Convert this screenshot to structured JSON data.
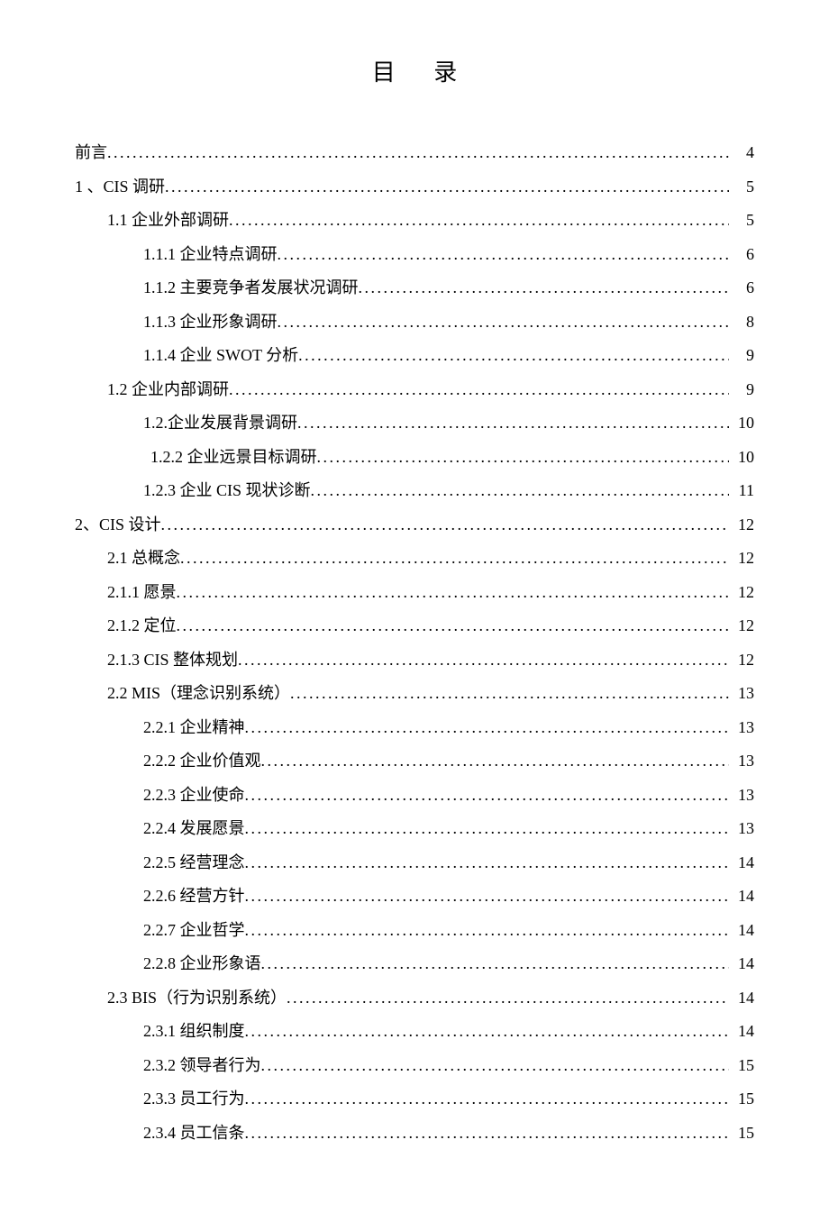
{
  "title": "目 录",
  "entries": [
    {
      "indent": 0,
      "label": "前言",
      "page": "4"
    },
    {
      "indent": 0,
      "label": "1 、CIS 调研",
      "page": "5"
    },
    {
      "indent": 1,
      "label": "1.1 企业外部调研",
      "page": "5"
    },
    {
      "indent": 2,
      "label": "1.1.1 企业特点调研",
      "page": "6"
    },
    {
      "indent": 2,
      "label": "1.1.2 主要竞争者发展状况调研",
      "page": "6"
    },
    {
      "indent": 2,
      "label": "1.1.3 企业形象调研",
      "page": "8"
    },
    {
      "indent": 2,
      "label": "1.1.4 企业 SWOT 分析",
      "page": " 9"
    },
    {
      "indent": 1,
      "label": "1.2 企业内部调研",
      "page": "9"
    },
    {
      "indent": 2,
      "label": "1.2.企业发展背景调研",
      "page": "10"
    },
    {
      "indent": 3,
      "label": "1.2.2 企业远景目标调研",
      "page": "10"
    },
    {
      "indent": 2,
      "label": "1.2.3 企业 CIS 现状诊断",
      "page": "11"
    },
    {
      "indent": 0,
      "label": "2、CIS 设计",
      "page": "12"
    },
    {
      "indent": 1,
      "label": "2.1 总概念",
      "page": "12"
    },
    {
      "indent": 1,
      "label": "2.1.1 愿景",
      "page": "12"
    },
    {
      "indent": 1,
      "label": "2.1.2 定位",
      "page": "12"
    },
    {
      "indent": 1,
      "label": "2.1.3 CIS 整体规划 ",
      "page": "12"
    },
    {
      "indent": 1,
      "label": "2.2 MIS（理念识别系统）",
      "page": "13"
    },
    {
      "indent": 2,
      "label": "2.2.1 企业精神",
      "page": "13"
    },
    {
      "indent": 2,
      "label": "2.2.2 企业价值观",
      "page": "13"
    },
    {
      "indent": 2,
      "label": "2.2.3 企业使命",
      "page": "13"
    },
    {
      "indent": 2,
      "label": "2.2.4 发展愿景",
      "page": "13"
    },
    {
      "indent": 2,
      "label": "2.2.5 经营理念",
      "page": "14"
    },
    {
      "indent": 2,
      "label": "2.2.6 经营方针",
      "page": "14"
    },
    {
      "indent": 2,
      "label": "2.2.7 企业哲学",
      "page": "14"
    },
    {
      "indent": 2,
      "label": "2.2.8 企业形象语",
      "page": "14"
    },
    {
      "indent": 1,
      "label": "2.3 BIS（行为识别系统）",
      "page": "14"
    },
    {
      "indent": 2,
      "label": "2.3.1 组织制度",
      "page": "14"
    },
    {
      "indent": 2,
      "label": "2.3.2 领导者行为",
      "page": "15"
    },
    {
      "indent": 2,
      "label": "2.3.3 员工行为",
      "page": "15"
    },
    {
      "indent": 2,
      "label": "2.3.4 员工信条",
      "page": "15"
    }
  ]
}
